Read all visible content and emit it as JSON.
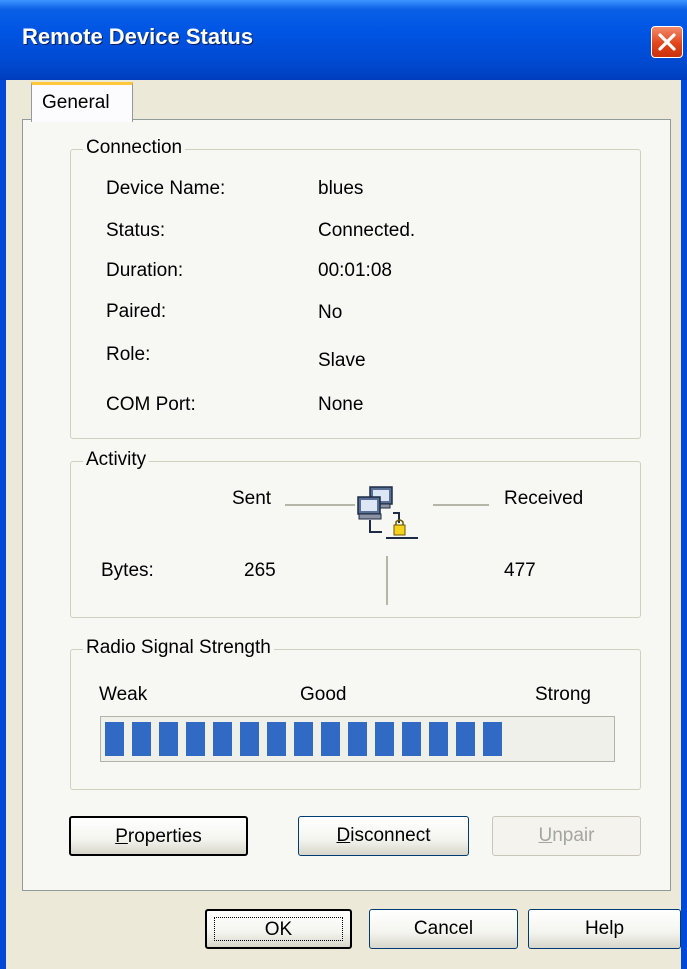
{
  "window": {
    "title": "Remote Device Status"
  },
  "tabs": [
    {
      "label": "General",
      "selected": true
    }
  ],
  "connection": {
    "group_label": "Connection",
    "rows": [
      {
        "label": "Device Name:",
        "value": "blues"
      },
      {
        "label": "Status:",
        "value": "Connected."
      },
      {
        "label": "Duration:",
        "value": "00:01:08"
      },
      {
        "label": "Paired:",
        "value": "No"
      },
      {
        "label": "Role:",
        "value": "Slave"
      },
      {
        "label": "COM Port:",
        "value": "None"
      }
    ]
  },
  "activity": {
    "group_label": "Activity",
    "sent_label": "Sent",
    "received_label": "Received",
    "bytes_label": "Bytes:",
    "bytes_sent": "265",
    "bytes_received": "477",
    "icon": "network-computers-icon"
  },
  "signal": {
    "group_label": "Radio Signal Strength",
    "weak_label": "Weak",
    "good_label": "Good",
    "strong_label": "Strong",
    "filled_segments": 15,
    "fill_fraction": 0.82,
    "bar_color": "#316ac5"
  },
  "actions": {
    "properties_prefix": "",
    "properties_mnemonic": "P",
    "properties_rest": "roperties",
    "disconnect_mnemonic": "D",
    "disconnect_rest": "isconnect",
    "unpair_mnemonic": "U",
    "unpair_rest": "npair",
    "unpair_enabled": false
  },
  "footer": {
    "ok_label": "OK",
    "cancel_label": "Cancel",
    "help_label": "Help"
  },
  "colors": {
    "title_bar": "#0054e3",
    "close_button": "#e1461c",
    "dialog_bg": "#ece9d8",
    "tab_highlight": "#ffc83c"
  }
}
